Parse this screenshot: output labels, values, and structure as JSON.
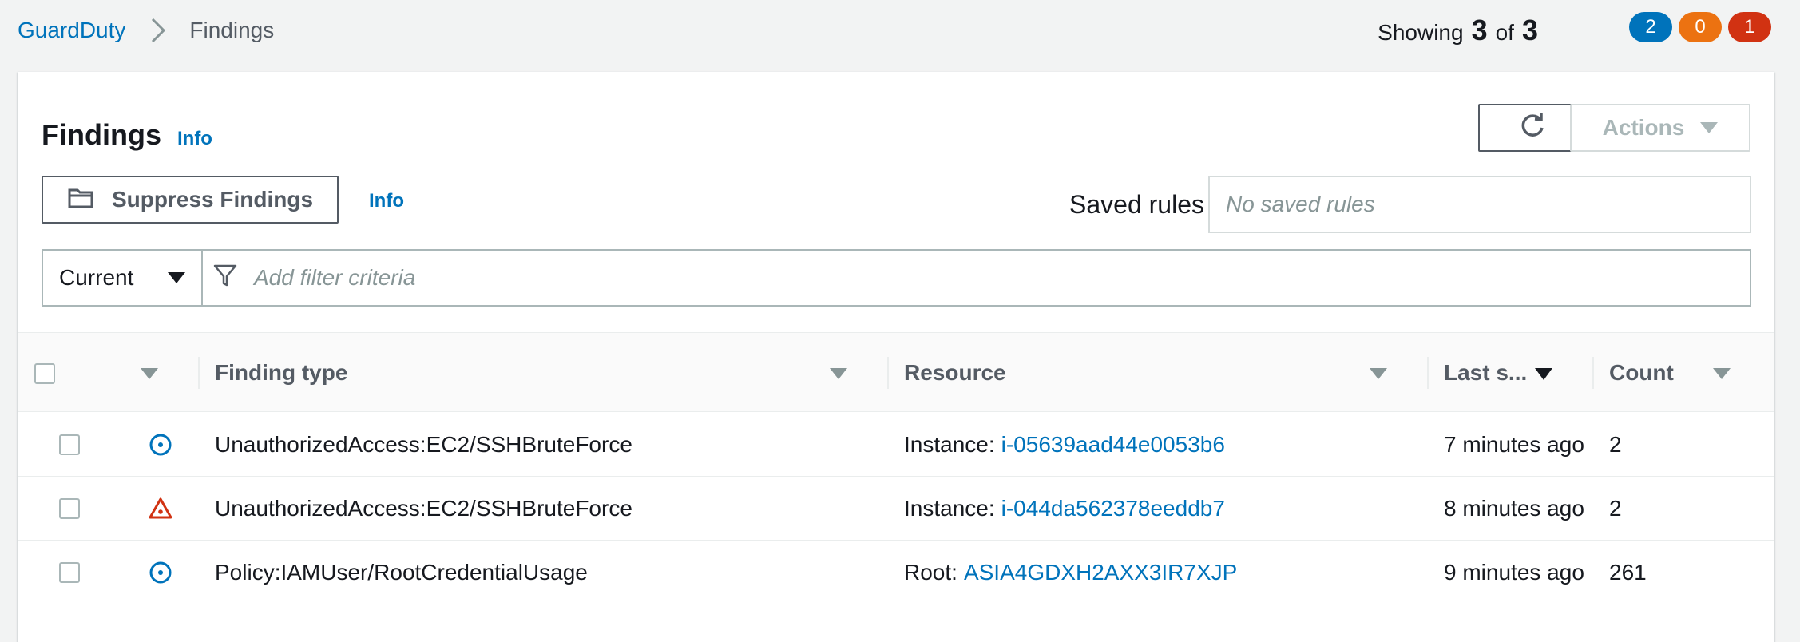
{
  "breadcrumb": {
    "root": "GuardDuty",
    "current": "Findings"
  },
  "summary": {
    "prefix": "Showing",
    "shown": "3",
    "of": "of",
    "total": "3"
  },
  "badges": [
    {
      "count": "2",
      "color": "#0073bb"
    },
    {
      "count": "0",
      "color": "#ec7211"
    },
    {
      "count": "1",
      "color": "#d13212"
    }
  ],
  "panel": {
    "title": "Findings",
    "title_info": "Info",
    "actions_label": "Actions",
    "suppress_label": "Suppress Findings",
    "suppress_info": "Info",
    "saved_rules_label": "Saved rules",
    "saved_rules_placeholder": "No saved rules",
    "scope_value": "Current",
    "filter_placeholder": "Add filter criteria"
  },
  "table": {
    "columns": [
      "Finding type",
      "Resource",
      "Last s...",
      "Count"
    ],
    "rows": [
      {
        "severity": "low",
        "finding_type": "UnauthorizedAccess:EC2/SSHBruteForce",
        "resource_prefix": "Instance:",
        "resource_id": "i-05639aad44e0053b6",
        "last_seen": "7 minutes ago",
        "count": "2"
      },
      {
        "severity": "high",
        "finding_type": "UnauthorizedAccess:EC2/SSHBruteForce",
        "resource_prefix": "Instance:",
        "resource_id": "i-044da562378eeddb7",
        "last_seen": "8 minutes ago",
        "count": "2"
      },
      {
        "severity": "low",
        "finding_type": "Policy:IAMUser/RootCredentialUsage",
        "resource_prefix": "Root:",
        "resource_id": "ASIA4GDXH2AXX3IR7XJP",
        "last_seen": "9 minutes ago",
        "count": "261"
      }
    ]
  },
  "colors": {
    "link": "#0073bb",
    "severity_low": "#0073bb",
    "severity_high": "#d13212"
  }
}
